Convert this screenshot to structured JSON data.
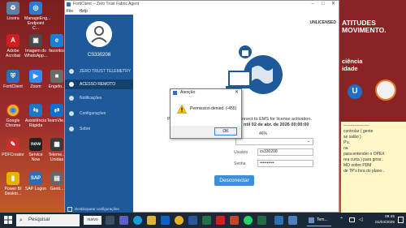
{
  "desktop_icons": [
    {
      "label": "Lixeira",
      "icon": "recycle-bin-icon",
      "color": "#5b7fa8"
    },
    {
      "label": "ManageEng... Endpoint C...",
      "icon": "manageengine-icon",
      "color": "#2d7ad0"
    },
    {
      "label": "Adobe Acrobat",
      "icon": "acrobat-icon",
      "color": "#d21e1e"
    },
    {
      "label": "Imagem do WhatsApp...",
      "icon": "whatsapp-image-icon",
      "color": "#4a4a4a"
    },
    {
      "label": "favoritos",
      "icon": "folder-icon",
      "color": "#e0b340"
    },
    {
      "label": "FortiClient",
      "icon": "forticlient-icon",
      "color": "#2f6fb5"
    },
    {
      "label": "Zoom",
      "icon": "zoom-icon",
      "color": "#2d8cff"
    },
    {
      "label": "Engefo...",
      "icon": "app-icon",
      "color": "#6b6b6b"
    },
    {
      "label": "Google Chrome",
      "icon": "chrome-icon",
      "color": "#e8b320"
    },
    {
      "label": "Assistência Rápida",
      "icon": "quick-assist-icon",
      "color": "#1b76c7"
    },
    {
      "label": "TeamVie...",
      "icon": "teamviewer-icon",
      "color": "#0e6fd1"
    },
    {
      "label": "PDFCreator",
      "icon": "pdfcreator-icon",
      "color": "#c9302c"
    },
    {
      "label": "Service Now",
      "icon": "servicenow-icon",
      "color": "#222222"
    },
    {
      "label": "Teleme... Unidas",
      "icon": "app-icon",
      "color": "#3a3a3a"
    },
    {
      "label": "Power BI Deskto...",
      "icon": "powerbi-icon",
      "color": "#e2b400"
    },
    {
      "label": "SAP Logon",
      "icon": "sap-icon",
      "color": "#2a6db8"
    },
    {
      "label": "Genti...",
      "icon": "app-icon",
      "color": "#666666"
    }
  ],
  "poster": {
    "line1": "ATITUDES",
    "line2": "MOVIMENTO.",
    "line3": "ciência",
    "line4": "idade"
  },
  "note_lines": [
    "-------------------",
    "controlar ( gente",
    "se salão )",
    "P's.",
    "na",
    "",
    "para entender o OPEX",
    "rea curta ) para giros .",
    "MO sobre PDM",
    "",
    "de TP's fora do plano ."
  ],
  "window": {
    "title": "FortiClient -- Zero Trust Fabric Agent",
    "menu": [
      "File",
      "Help"
    ],
    "username": "CS330208",
    "nav": [
      {
        "label": "ZERO TRUST TELEMETRY",
        "active": false
      },
      {
        "label": "ACESSO REMOTO",
        "active": true
      },
      {
        "label": "Notificações",
        "active": false
      },
      {
        "label": "Configurações",
        "active": false
      },
      {
        "label": "Sobre",
        "active": false
      }
    ],
    "footer": "Desbloquear configurações",
    "unlicensed": "UNLICENSED",
    "ems_text_left": "P",
    "ems_text": "nnect to EMS for license activation.",
    "ems_date": "ntil 02 de abr. de 2026 00:00:00",
    "progress_pct": "46%",
    "user_label": "Usuário",
    "user_value": "cs330208",
    "pass_label": "Senha",
    "pass_value": "••••••••••",
    "disconnect": "Desconectar"
  },
  "dialog": {
    "title": "Atenção",
    "message": "Permission denied. (-455)",
    "ok": "OK"
  },
  "taskbar": {
    "search_placeholder": "Pesquisar",
    "search_tag": "nuvvo",
    "tray_app": "Tem...",
    "time": "09:45",
    "date": "01/04/2025"
  }
}
